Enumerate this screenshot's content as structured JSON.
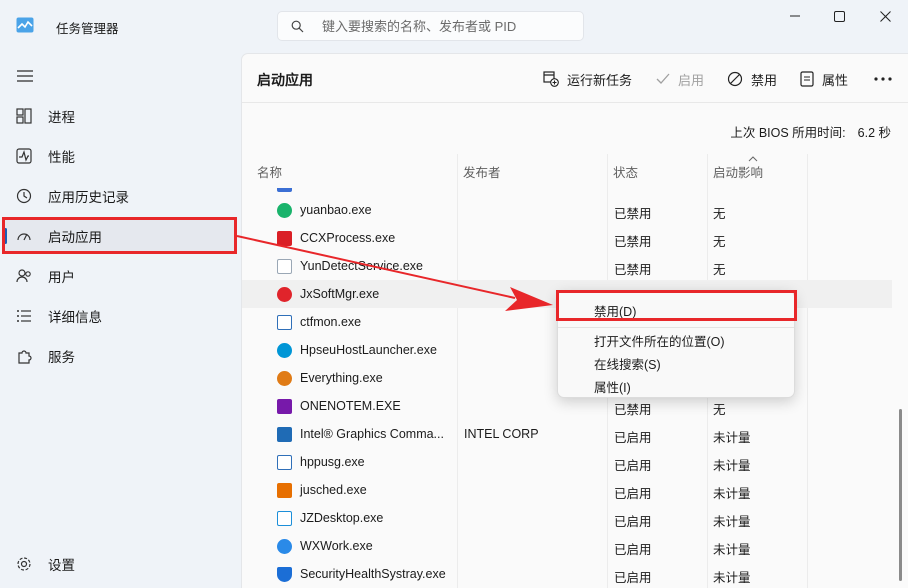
{
  "app": {
    "title": "任务管理器"
  },
  "search": {
    "placeholder": "键入要搜索的名称、发布者或 PID"
  },
  "sidebar": {
    "items": [
      {
        "label": "进程"
      },
      {
        "label": "性能"
      },
      {
        "label": "应用历史记录"
      },
      {
        "label": "启动应用"
      },
      {
        "label": "用户"
      },
      {
        "label": "详细信息"
      },
      {
        "label": "服务"
      }
    ],
    "settings_label": "设置"
  },
  "main": {
    "title": "启动应用",
    "toolbar": {
      "run_new_task": "运行新任务",
      "enable": "启用",
      "disable": "禁用",
      "properties": "属性"
    },
    "bios_label": "上次 BIOS 所用时间:",
    "bios_value": "6.2 秒",
    "columns": {
      "name": "名称",
      "publisher": "发布者",
      "status": "状态",
      "impact": "启动影响"
    },
    "rows": [
      {
        "name": "yuanbao.exe",
        "publisher": "",
        "status": "已禁用",
        "impact": "无",
        "icon": "yuanbao-icon",
        "color": "#19b36b"
      },
      {
        "name": "CCXProcess.exe",
        "publisher": "",
        "status": "已禁用",
        "impact": "无",
        "icon": "adobe-cc-icon",
        "color": "#da1f26"
      },
      {
        "name": "YunDetectService.exe",
        "publisher": "",
        "status": "已禁用",
        "impact": "无",
        "icon": "file-icon",
        "color": "#9aa7b5"
      },
      {
        "name": "JxSoftMgr.exe",
        "publisher": "",
        "status": "",
        "impact": "",
        "icon": "jxsoft-icon",
        "color": "#e0242b"
      },
      {
        "name": "ctfmon.exe",
        "publisher": "",
        "status": "",
        "impact": "",
        "icon": "window-icon",
        "color": "#2f6fb8"
      },
      {
        "name": "HpseuHostLauncher.exe",
        "publisher": "",
        "status": "",
        "impact": "",
        "icon": "hp-icon",
        "color": "#0096d6"
      },
      {
        "name": "Everything.exe",
        "publisher": "",
        "status": "",
        "impact": "",
        "icon": "magnifier-icon",
        "color": "#e07b16"
      },
      {
        "name": "ONENOTEM.EXE",
        "publisher": "",
        "status": "已禁用",
        "impact": "无",
        "icon": "onenote-icon",
        "color": "#7719aa"
      },
      {
        "name": "Intel® Graphics Comma...",
        "publisher": "INTEL CORP",
        "status": "已启用",
        "impact": "未计量",
        "icon": "intel-icon",
        "color": "#1f6bb5"
      },
      {
        "name": "hppusg.exe",
        "publisher": "",
        "status": "已启用",
        "impact": "未计量",
        "icon": "window-icon",
        "color": "#2f6fb8"
      },
      {
        "name": "jusched.exe",
        "publisher": "",
        "status": "已启用",
        "impact": "未计量",
        "icon": "java-icon",
        "color": "#e76f00"
      },
      {
        "name": "JZDesktop.exe",
        "publisher": "",
        "status": "已启用",
        "impact": "未计量",
        "icon": "desktop-icon",
        "color": "#1c8fd9"
      },
      {
        "name": "WXWork.exe",
        "publisher": "",
        "status": "已启用",
        "impact": "未计量",
        "icon": "wxwork-icon",
        "color": "#2a8ae8"
      },
      {
        "name": "SecurityHealthSystray.exe",
        "publisher": "",
        "status": "已启用",
        "impact": "未计量",
        "icon": "shield-icon",
        "color": "#1b6ed6"
      }
    ]
  },
  "context_menu": {
    "items": [
      {
        "label": "禁用(D)"
      },
      {
        "label": "打开文件所在的位置(O)"
      },
      {
        "label": "在线搜索(S)"
      },
      {
        "label": "属性(I)"
      }
    ]
  },
  "colors": {
    "accent": "#1a5fb4",
    "annotation": "#e8272a"
  }
}
